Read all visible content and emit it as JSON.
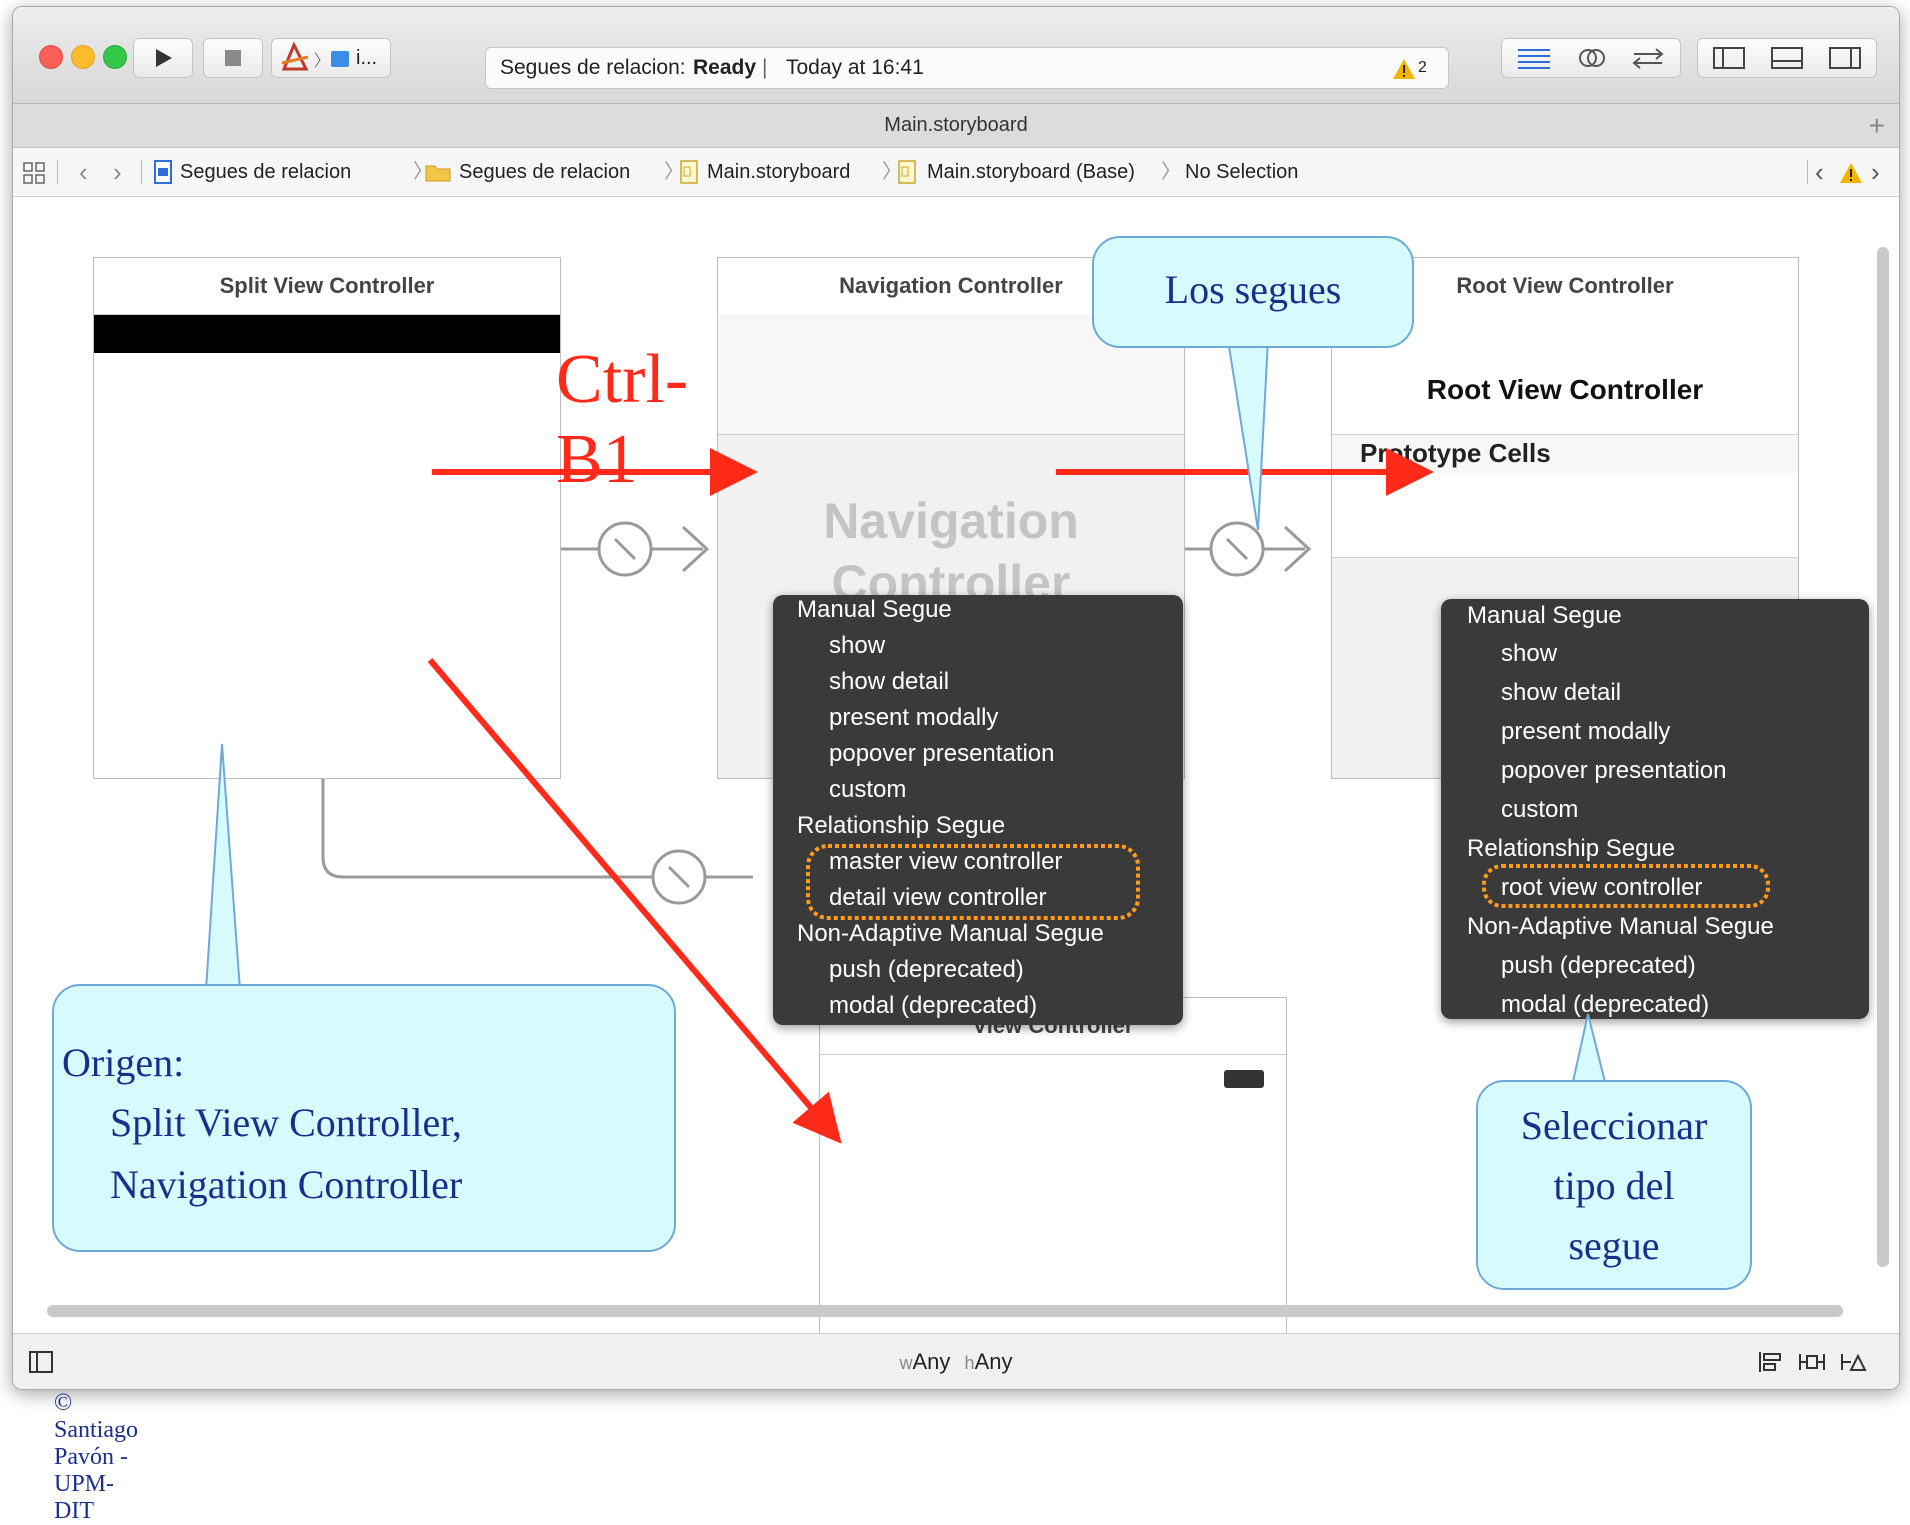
{
  "toolbar": {
    "scheme_label": "i...",
    "status_project": "Segues de relacion:",
    "status_state": "Ready",
    "status_sep": "|",
    "status_time": "Today at 16:41",
    "warning_count": "2"
  },
  "tab": {
    "title": "Main.storyboard",
    "add": "+"
  },
  "jumpbar": {
    "crumbs": [
      "Segues de relacion",
      "Segues de relacion",
      "Main.storyboard",
      "Main.storyboard (Base)",
      "No Selection"
    ]
  },
  "scenes": {
    "split": {
      "title": "Split View Controller"
    },
    "nav": {
      "title": "Navigation Controller",
      "watermark_line1": "Navigation",
      "watermark_line2": "Controller"
    },
    "root": {
      "title": "Root View Controller",
      "nav_title": "Root View Controller",
      "section": "Prototype Cells"
    },
    "detail": {
      "title": "View Controller"
    }
  },
  "menu_left": {
    "items": [
      "Manual Segue",
      "show",
      "show detail",
      "present modally",
      "popover presentation",
      "custom",
      "Relationship Segue",
      "master view controller",
      "detail view controller",
      "Non-Adaptive Manual Segue",
      "push (deprecated)",
      "modal (deprecated)"
    ]
  },
  "menu_right": {
    "items": [
      "Manual Segue",
      "show",
      "show detail",
      "present modally",
      "popover presentation",
      "custom",
      "Relationship Segue",
      "root view controller",
      "Non-Adaptive Manual Segue",
      "push (deprecated)",
      "modal (deprecated)"
    ]
  },
  "annotations": {
    "ctrl": "Ctrl-B1",
    "los_segues": "Los segues",
    "origen_title": "Origen:",
    "origen_line1": "Split View Controller,",
    "origen_line2": "Navigation Controller",
    "sel_line1": "Seleccionar",
    "sel_line2": "tipo del",
    "sel_line3": "segue"
  },
  "bottom": {
    "w_prefix": "w",
    "w_value": "Any",
    "h_prefix": "h",
    "h_value": "Any"
  },
  "footer": {
    "copyright": "© Santiago Pavón - UPM-DIT"
  },
  "colors": {
    "annotation_red": "#ff2a1a",
    "callout_fill": "#d7fbfd",
    "highlight_orange": "#ff9a1a",
    "menu_bg": "#3a3a3a"
  }
}
